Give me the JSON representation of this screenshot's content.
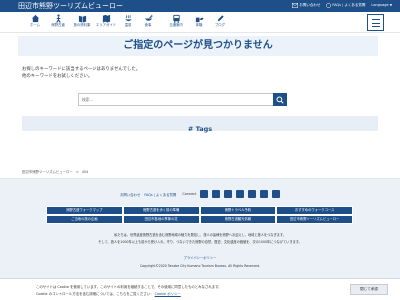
{
  "header": {
    "site_title": "田辺市熊野ツーリズムビューロー",
    "links": {
      "contact": "お問い合わせ",
      "faq": "FAQs | よくある質問",
      "language": "Language"
    }
  },
  "nav": {
    "items": [
      {
        "label": "ホーム",
        "icon": "home-icon"
      },
      {
        "label": "熊野古道",
        "icon": "walker-icon"
      },
      {
        "label": "旅の資料集",
        "icon": "book-icon"
      },
      {
        "label": "エリアガイド",
        "icon": "map-icon"
      },
      {
        "label": "温泉",
        "icon": "onsen-icon"
      },
      {
        "label": "食事",
        "icon": "food-icon"
      },
      {
        "label": "交通案内",
        "icon": "bus-icon"
      },
      {
        "label": "体験",
        "icon": "experience-icon"
      },
      {
        "label": "ブログ",
        "icon": "blog-icon"
      }
    ],
    "menu_icon": "hamburger-icon"
  },
  "main": {
    "title": "ご指定のページが見つかりません",
    "message_1": "お探しのキーワードに該当するページはありませんでした。",
    "message_2": "他のキーワードをお試しください。",
    "search_placeholder": "検索...",
    "tags_label": "# Tags"
  },
  "breadcrumb": {
    "home": "田辺市熊野ツーリズムビューロー",
    "separator": ">",
    "current": "404"
  },
  "footer": {
    "contact": "お問い合わせ",
    "faq": "FAQs | よくある質問",
    "connect": "Connect",
    "sns_icons": [
      "facebook-icon",
      "twitter-icon",
      "instagram-icon",
      "youtube-icon",
      "tiktok-icon",
      "line-icon",
      "email-icon"
    ],
    "grid": [
      "熊野古道ウォークマップ",
      "熊野古道を歩く前の準備",
      "熊野トラベル予約",
      "おすすめのウォークコース",
      "ご当地の旅の企画",
      "田辺市各地の季節の花",
      "熊野古道観光情報",
      "田辺市熊野ツーリズムビューロー"
    ],
    "desc_1": "私たちは、世界遺産熊野古道を含む熊野地域の魅力を発信し、旅人の皆様を熊野へお迎えし、地域と旅人をつなぎます。",
    "desc_2": "そして、旅人を1000年以上も前から受け入れ、守り、つないできた熊野の自然、歴史、文化遺産の価値を、次の1000年につなげていきます。",
    "privacy": "プライバシーポリシー",
    "copyright": "Copyright©2020 Tanabe City Kumano Tourism Bureau. All Rights Reserved."
  },
  "cookie": {
    "line_1": "このサイトは Cookie を使用しています。このサイトの利用を継続することで、その使用に同意したものとみなされます。",
    "line_2": "Cookie のコントロール方法を含む詳細については、こちらをご覧ください：",
    "policy_link": "Cookie ポリシー",
    "close_button": "閉じて承認"
  },
  "colors": {
    "brand": "#1e4f88",
    "footer_bg": "#ecf1f7",
    "title_bg": "#ecf2f9"
  }
}
